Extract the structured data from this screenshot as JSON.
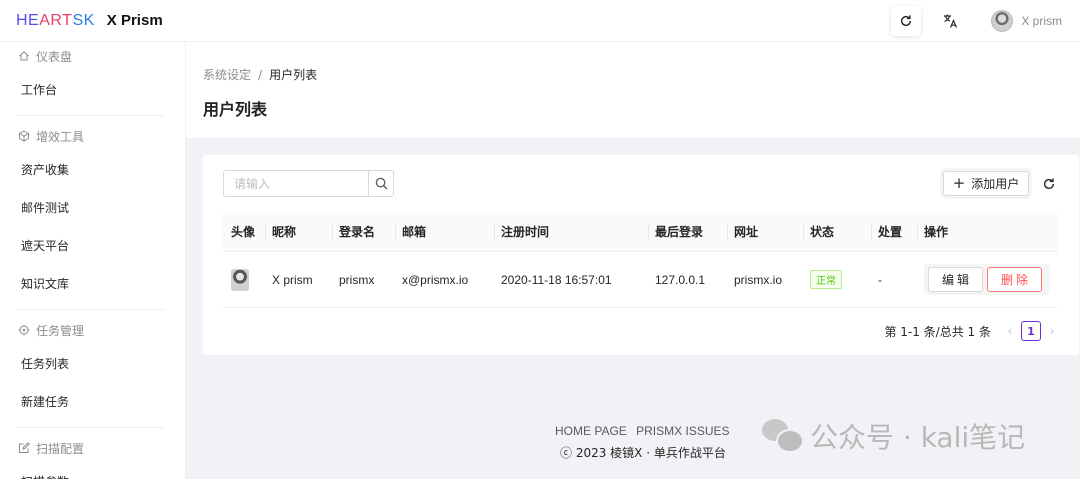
{
  "header": {
    "logo": [
      "HE",
      "ART",
      "SK"
    ],
    "title": "X Prism",
    "user_name": "X prism",
    "icons": [
      "reload-icon",
      "translate-icon"
    ]
  },
  "sidebar": {
    "groups": [
      {
        "title": "仪表盘",
        "icon": "home-icon",
        "items": [
          "工作台"
        ]
      },
      {
        "title": "增效工具",
        "icon": "cube-icon",
        "items": [
          "资产收集",
          "邮件测试",
          "遮天平台",
          "知识文库"
        ]
      },
      {
        "title": "任务管理",
        "icon": "target-icon",
        "items": [
          "任务列表",
          "新建任务"
        ]
      },
      {
        "title": "扫描配置",
        "icon": "edit-icon",
        "items": [
          "扫描参数"
        ]
      }
    ]
  },
  "page": {
    "breadcrumb": [
      "系统设定",
      "用户列表"
    ],
    "breadcrumb_sep": "/",
    "title": "用户列表"
  },
  "toolbar": {
    "search_placeholder": "请输入",
    "add_label": "添加用户"
  },
  "table": {
    "columns": [
      "头像",
      "昵称",
      "登录名",
      "邮箱",
      "注册时间",
      "最后登录",
      "网址",
      "状态",
      "处置",
      "操作"
    ],
    "rows": [
      {
        "nickname": "X prism",
        "login": "prismx",
        "email": "x@prismx.io",
        "registered": "2020-11-18 16:57:01",
        "last_login": "127.0.0.1",
        "site": "prismx.io",
        "status": "正常",
        "action": "-",
        "edit_label": "编辑",
        "delete_label": "删除"
      }
    ]
  },
  "pagination": {
    "total_text": "第 1-1 条/总共 1 条",
    "prev": "‹",
    "next": "›",
    "current": "1"
  },
  "footer": {
    "links": [
      "HOME PAGE",
      "PRISMX ISSUES"
    ],
    "copyright": "ⓒ 2023 棱镜X · 单兵作战平台"
  },
  "watermark": "公众号 · kali笔记",
  "colors": {
    "accent": "#722ed1",
    "danger": "#ff4d4f",
    "success": "#52c41a"
  }
}
